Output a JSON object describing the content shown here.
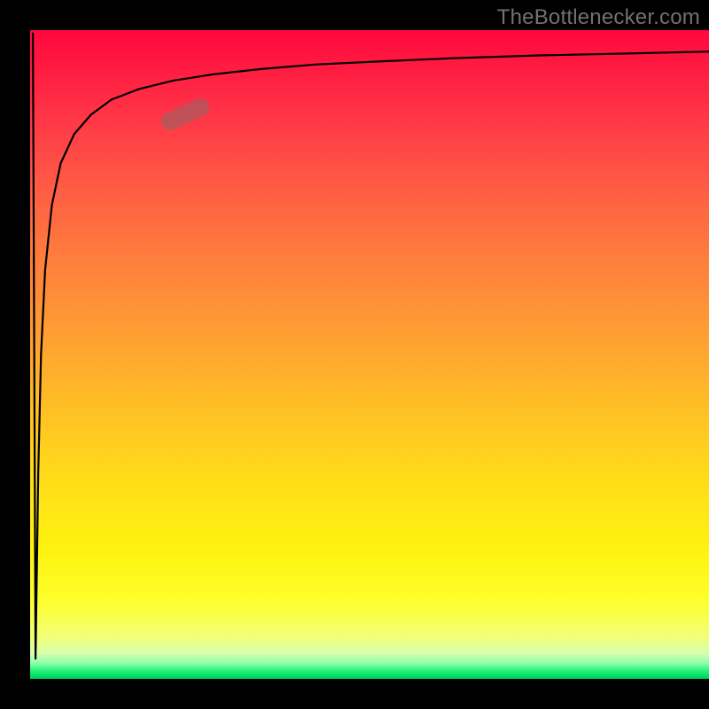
{
  "watermark": "TheBottlenecker.com",
  "chart_data": {
    "type": "line",
    "title": "",
    "xlabel": "",
    "ylabel": "",
    "xlim": [
      0,
      100
    ],
    "ylim": [
      0,
      100
    ],
    "grid": false,
    "legend": false,
    "note": "No numeric axes are rendered in the image; values are inferred as 0–100 % of plot area.",
    "series": [
      {
        "name": "value-curve",
        "style": "solid-black",
        "x": [
          0.4,
          0.8,
          1.2,
          1.6,
          2.2,
          3.2,
          4.5,
          6.5,
          9.0,
          12.0,
          16.0,
          21.0,
          27.0,
          34.0,
          42.0,
          52.0,
          63.0,
          75.0,
          88.0,
          100.0
        ],
        "y": [
          99.5,
          3.0,
          32.0,
          50.0,
          63.0,
          73.0,
          79.5,
          84.0,
          87.0,
          89.3,
          90.9,
          92.2,
          93.2,
          94.0,
          94.7,
          95.2,
          95.7,
          96.1,
          96.4,
          96.7
        ]
      }
    ],
    "marker": {
      "name": "highlight-segment",
      "center_x": 22.8,
      "center_y": 87.0,
      "angle_deg": -24
    },
    "background_gradient": {
      "top": "#ff073e",
      "mid": "#fff210",
      "bottom": "#00ce62"
    }
  }
}
